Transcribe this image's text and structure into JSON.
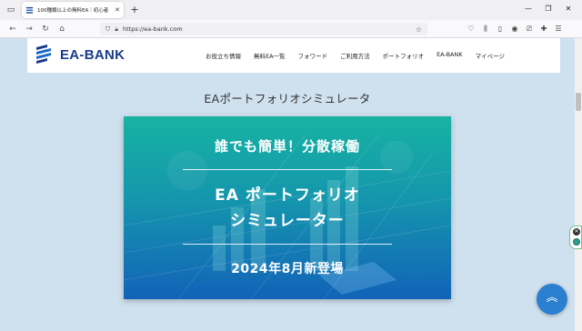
{
  "browser": {
    "tab_title": "100種類以上の無料EA｜初心者",
    "new_tab": "+",
    "url": "https://ea-bank.com"
  },
  "site": {
    "logo_text": "EA-BANK",
    "nav": [
      "お役立ち情報",
      "無料EA一覧",
      "フォワード",
      "ご利用方法",
      "ポートフォリオ",
      "EA-BANK",
      "マイページ"
    ]
  },
  "page": {
    "title": "EAポートフォリオシミュレータ"
  },
  "banner": {
    "tagline": "誰でも簡単！分散稼働",
    "title_line1": "EA ポートフォリオ",
    "title_line2": "シミュレーター",
    "release": "2024年8月新登場"
  },
  "colors": {
    "brand": "#1a3b8a",
    "banner_top": "#17b3a2",
    "banner_bottom": "#1263b8",
    "to_top_button": "#2b7fd0"
  }
}
